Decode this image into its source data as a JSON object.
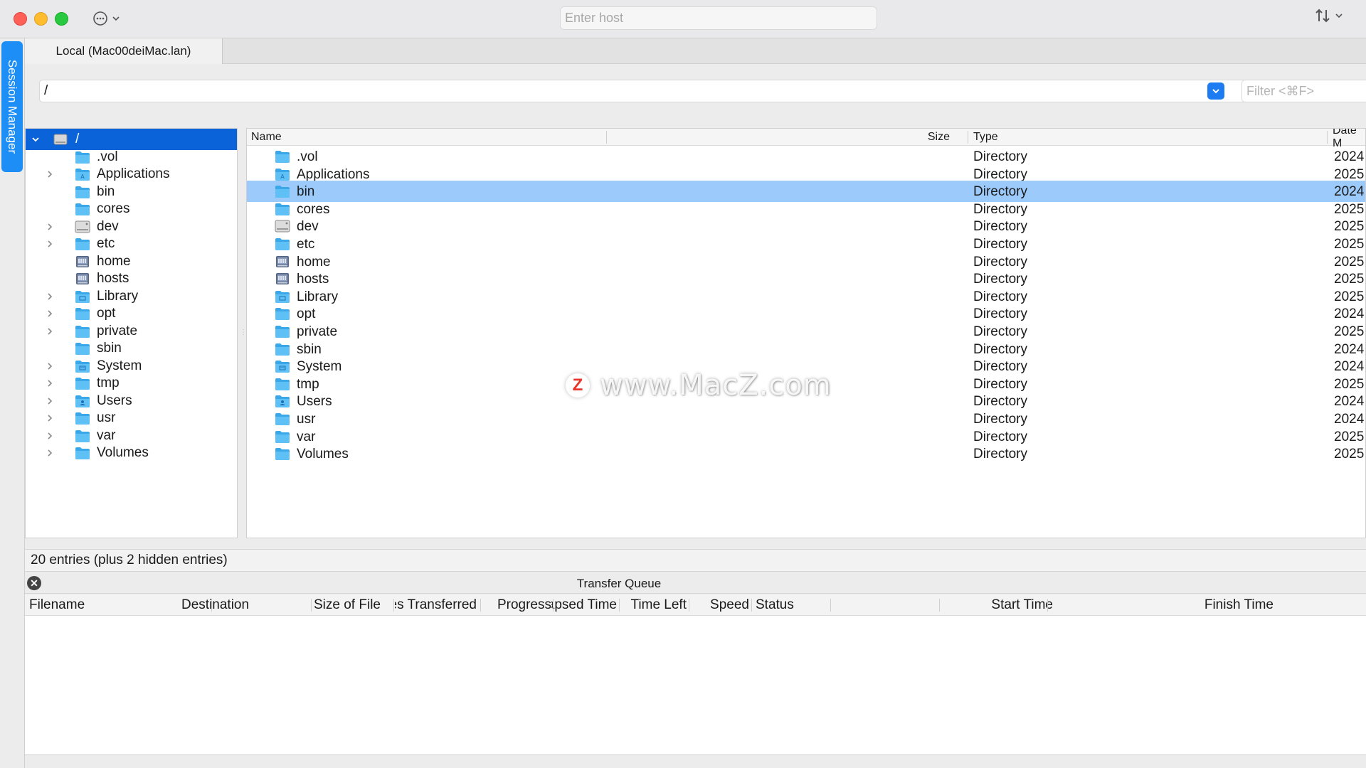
{
  "window": {
    "host_placeholder": "Enter host",
    "session_manager_label": "Session Manager",
    "tab_label": "Local (Mac00deiMac.lan)"
  },
  "pathbar": {
    "path_value": "/",
    "filter_placeholder": "Filter <⌘F>"
  },
  "tree": {
    "root_label": "/",
    "items": [
      {
        "label": ".vol",
        "expandable": false,
        "icon": "folder-icon"
      },
      {
        "label": "Applications",
        "expandable": true,
        "icon": "applications-folder-icon"
      },
      {
        "label": "bin",
        "expandable": false,
        "icon": "folder-icon"
      },
      {
        "label": "cores",
        "expandable": false,
        "icon": "folder-icon"
      },
      {
        "label": "dev",
        "expandable": true,
        "icon": "disk-icon"
      },
      {
        "label": "etc",
        "expandable": true,
        "icon": "folder-icon"
      },
      {
        "label": "home",
        "expandable": false,
        "icon": "network-drive-icon"
      },
      {
        "label": "hosts",
        "expandable": false,
        "icon": "network-drive-icon"
      },
      {
        "label": "Library",
        "expandable": true,
        "icon": "library-folder-icon"
      },
      {
        "label": "opt",
        "expandable": true,
        "icon": "folder-icon"
      },
      {
        "label": "private",
        "expandable": true,
        "icon": "folder-icon"
      },
      {
        "label": "sbin",
        "expandable": false,
        "icon": "folder-icon"
      },
      {
        "label": "System",
        "expandable": true,
        "icon": "system-folder-icon"
      },
      {
        "label": "tmp",
        "expandable": true,
        "icon": "folder-icon"
      },
      {
        "label": "Users",
        "expandable": true,
        "icon": "users-folder-icon"
      },
      {
        "label": "usr",
        "expandable": true,
        "icon": "folder-icon"
      },
      {
        "label": "var",
        "expandable": true,
        "icon": "folder-icon"
      },
      {
        "label": "Volumes",
        "expandable": true,
        "icon": "folder-icon"
      }
    ]
  },
  "list": {
    "columns": {
      "name": "Name",
      "size": "Size",
      "type": "Type",
      "date": "Date M"
    },
    "rows": [
      {
        "name": ".vol",
        "size": "",
        "type": "Directory",
        "date": "2024",
        "icon": "folder-icon",
        "selected": false
      },
      {
        "name": "Applications",
        "size": "",
        "type": "Directory",
        "date": "2025",
        "icon": "applications-folder-icon",
        "selected": false
      },
      {
        "name": "bin",
        "size": "",
        "type": "Directory",
        "date": "2024",
        "icon": "folder-icon",
        "selected": true
      },
      {
        "name": "cores",
        "size": "",
        "type": "Directory",
        "date": "2025",
        "icon": "folder-icon",
        "selected": false
      },
      {
        "name": "dev",
        "size": "",
        "type": "Directory",
        "date": "2025",
        "icon": "disk-icon",
        "selected": false
      },
      {
        "name": "etc",
        "size": "",
        "type": "Directory",
        "date": "2025",
        "icon": "folder-icon",
        "selected": false
      },
      {
        "name": "home",
        "size": "",
        "type": "Directory",
        "date": "2025",
        "icon": "network-drive-icon",
        "selected": false
      },
      {
        "name": "hosts",
        "size": "",
        "type": "Directory",
        "date": "2025",
        "icon": "network-drive-icon",
        "selected": false
      },
      {
        "name": "Library",
        "size": "",
        "type": "Directory",
        "date": "2025",
        "icon": "library-folder-icon",
        "selected": false
      },
      {
        "name": "opt",
        "size": "",
        "type": "Directory",
        "date": "2024",
        "icon": "folder-icon",
        "selected": false
      },
      {
        "name": "private",
        "size": "",
        "type": "Directory",
        "date": "2025",
        "icon": "folder-icon",
        "selected": false
      },
      {
        "name": "sbin",
        "size": "",
        "type": "Directory",
        "date": "2024",
        "icon": "folder-icon",
        "selected": false
      },
      {
        "name": "System",
        "size": "",
        "type": "Directory",
        "date": "2024",
        "icon": "system-folder-icon",
        "selected": false
      },
      {
        "name": "tmp",
        "size": "",
        "type": "Directory",
        "date": "2025",
        "icon": "folder-icon",
        "selected": false
      },
      {
        "name": "Users",
        "size": "",
        "type": "Directory",
        "date": "2024",
        "icon": "users-folder-icon",
        "selected": false
      },
      {
        "name": "usr",
        "size": "",
        "type": "Directory",
        "date": "2024",
        "icon": "folder-icon",
        "selected": false
      },
      {
        "name": "var",
        "size": "",
        "type": "Directory",
        "date": "2025",
        "icon": "folder-icon",
        "selected": false
      },
      {
        "name": "Volumes",
        "size": "",
        "type": "Directory",
        "date": "2025",
        "icon": "folder-icon",
        "selected": false
      }
    ]
  },
  "watermark": {
    "logo_letter": "Z",
    "text": "www.MacZ.com"
  },
  "status": {
    "text": "20 entries (plus 2 hidden entries)"
  },
  "transfer_queue": {
    "title": "Transfer Queue",
    "columns": [
      "Filename",
      "Destination",
      "Size of File",
      "Bytes Transferred",
      "Progress",
      "Elapsed Time",
      "Time Left",
      "Speed",
      "Status",
      "Start Time",
      "Finish Time"
    ]
  },
  "colors": {
    "accent": "#0b63da",
    "selection_row": "#9ccbfb",
    "folder": "#3aa7e9",
    "session_tab": "#1e8ef7"
  }
}
